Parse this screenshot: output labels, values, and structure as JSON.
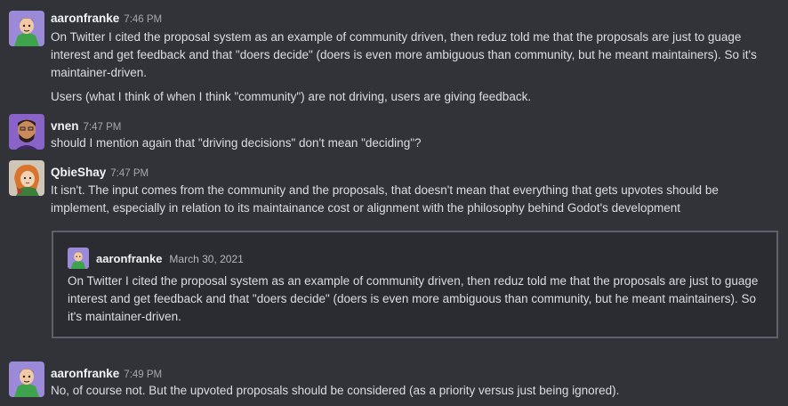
{
  "messages": [
    {
      "author": "aaronfranke",
      "time": "7:46 PM",
      "avatar": "aaronfranke-avatar",
      "paragraphs": [
        "On Twitter I cited the proposal system as an example of community driven, then reduz told me that the proposals are just to guage interest and get feedback and that \"doers decide\" (doers is even more ambiguous than community, but he meant maintainers). So it's maintainer-driven.",
        "Users (what I think of when I think \"community\") are not driving, users are giving feedback."
      ]
    },
    {
      "author": "vnen",
      "time": "7:47 PM",
      "avatar": "vnen-avatar",
      "paragraphs": [
        "should I mention again that \"driving decisions\" don't mean \"deciding\"?"
      ]
    },
    {
      "author": "QbieShay",
      "time": "7:47 PM",
      "avatar": "qbieshay-avatar",
      "paragraphs": [
        "It isn't. The input comes from the community and the proposals, that doesn't mean that everything that gets upvotes should be implement, especially in relation to its maintainance cost or alignment with the philosophy behind Godot's development"
      ],
      "quote": {
        "author": "aaronfranke",
        "date": "March 30, 2021",
        "text": "On Twitter I cited the proposal system as an example of community driven, then reduz told me that the proposals are just to guage interest and get feedback and that \"doers decide\" (doers is even more ambiguous than community, but he meant maintainers). So it's maintainer-driven."
      }
    },
    {
      "author": "aaronfranke",
      "time": "7:49 PM",
      "avatar": "aaronfranke-avatar",
      "paragraphs": [
        "No, of course not. But the upvoted proposals should be considered (as a priority versus just being ignored)."
      ]
    }
  ],
  "colors": {
    "background": "#323339",
    "author": "#f2f3f5",
    "timestamp": "#a6a8ae",
    "text": "#dbdee1",
    "quote_border": "#5f6068"
  }
}
